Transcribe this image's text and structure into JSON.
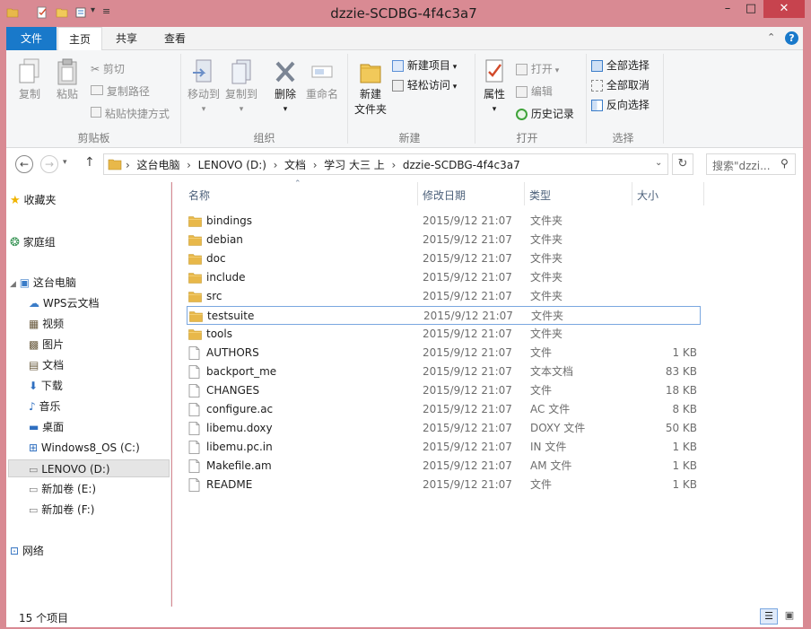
{
  "window": {
    "title": "dzzie-SCDBG-4f4c3a7",
    "minimize": "–",
    "maximize": "□",
    "close": "✕"
  },
  "tabs": {
    "file": "文件",
    "home": "主页",
    "share": "共享",
    "view": "查看"
  },
  "ribbon": {
    "clipboard": {
      "label": "剪贴板",
      "copy": "复制",
      "paste": "粘贴",
      "cut": "剪切",
      "copy_path": "复制路径",
      "paste_shortcut": "粘贴快捷方式"
    },
    "organize": {
      "label": "组织",
      "move_to": "移动到",
      "copy_to": "复制到",
      "delete": "删除",
      "rename": "重命名"
    },
    "new": {
      "label": "新建",
      "new_folder_line1": "新建",
      "new_folder_line2": "文件夹",
      "new_item": "新建项目",
      "easy_access": "轻松访问"
    },
    "open": {
      "label": "打开",
      "properties": "属性",
      "open": "打开",
      "edit": "编辑",
      "history": "历史记录"
    },
    "select": {
      "label": "选择",
      "select_all": "全部选择",
      "select_none": "全部取消",
      "invert": "反向选择"
    }
  },
  "address": {
    "crumbs": [
      "这台电脑",
      "LENOVO (D:)",
      "文档",
      "学习 大三 上",
      "dzzie-SCDBG-4f4c3a7"
    ],
    "search_placeholder": "搜索\"dzzi...",
    "sep": "›"
  },
  "nav": {
    "favorites": "收藏夹",
    "homegroup": "家庭组",
    "this_pc": "这台电脑",
    "items": [
      "WPS云文档",
      "视频",
      "图片",
      "文档",
      "下载",
      "音乐",
      "桌面",
      "Windows8_OS (C:)",
      "LENOVO (D:)",
      "新加卷 (E:)",
      "新加卷 (F:)"
    ],
    "network": "网络"
  },
  "columns": {
    "name": "名称",
    "date": "修改日期",
    "type": "类型",
    "size": "大小"
  },
  "files": [
    {
      "name": "bindings",
      "date": "2015/9/12 21:07",
      "type": "文件夹",
      "size": "",
      "kind": "folder"
    },
    {
      "name": "debian",
      "date": "2015/9/12 21:07",
      "type": "文件夹",
      "size": "",
      "kind": "folder"
    },
    {
      "name": "doc",
      "date": "2015/9/12 21:07",
      "type": "文件夹",
      "size": "",
      "kind": "folder"
    },
    {
      "name": "include",
      "date": "2015/9/12 21:07",
      "type": "文件夹",
      "size": "",
      "kind": "folder"
    },
    {
      "name": "src",
      "date": "2015/9/12 21:07",
      "type": "文件夹",
      "size": "",
      "kind": "folder"
    },
    {
      "name": "testsuite",
      "date": "2015/9/12 21:07",
      "type": "文件夹",
      "size": "",
      "kind": "folder"
    },
    {
      "name": "tools",
      "date": "2015/9/12 21:07",
      "type": "文件夹",
      "size": "",
      "kind": "folder"
    },
    {
      "name": "AUTHORS",
      "date": "2015/9/12 21:07",
      "type": "文件",
      "size": "1 KB",
      "kind": "file"
    },
    {
      "name": "backport_me",
      "date": "2015/9/12 21:07",
      "type": "文本文档",
      "size": "83 KB",
      "kind": "file"
    },
    {
      "name": "CHANGES",
      "date": "2015/9/12 21:07",
      "type": "文件",
      "size": "18 KB",
      "kind": "file"
    },
    {
      "name": "configure.ac",
      "date": "2015/9/12 21:07",
      "type": "AC 文件",
      "size": "8 KB",
      "kind": "file"
    },
    {
      "name": "libemu.doxy",
      "date": "2015/9/12 21:07",
      "type": "DOXY 文件",
      "size": "50 KB",
      "kind": "file"
    },
    {
      "name": "libemu.pc.in",
      "date": "2015/9/12 21:07",
      "type": "IN 文件",
      "size": "1 KB",
      "kind": "file"
    },
    {
      "name": "Makefile.am",
      "date": "2015/9/12 21:07",
      "type": "AM 文件",
      "size": "1 KB",
      "kind": "file"
    },
    {
      "name": "README",
      "date": "2015/9/12 21:07",
      "type": "文件",
      "size": "1 KB",
      "kind": "file"
    }
  ],
  "status": {
    "count": "15 个项目"
  },
  "colors": {
    "titlebar": "#d98a93",
    "accent": "#1979ca",
    "folder": "#e8b84a",
    "selection_border": "#7aa7e0"
  }
}
